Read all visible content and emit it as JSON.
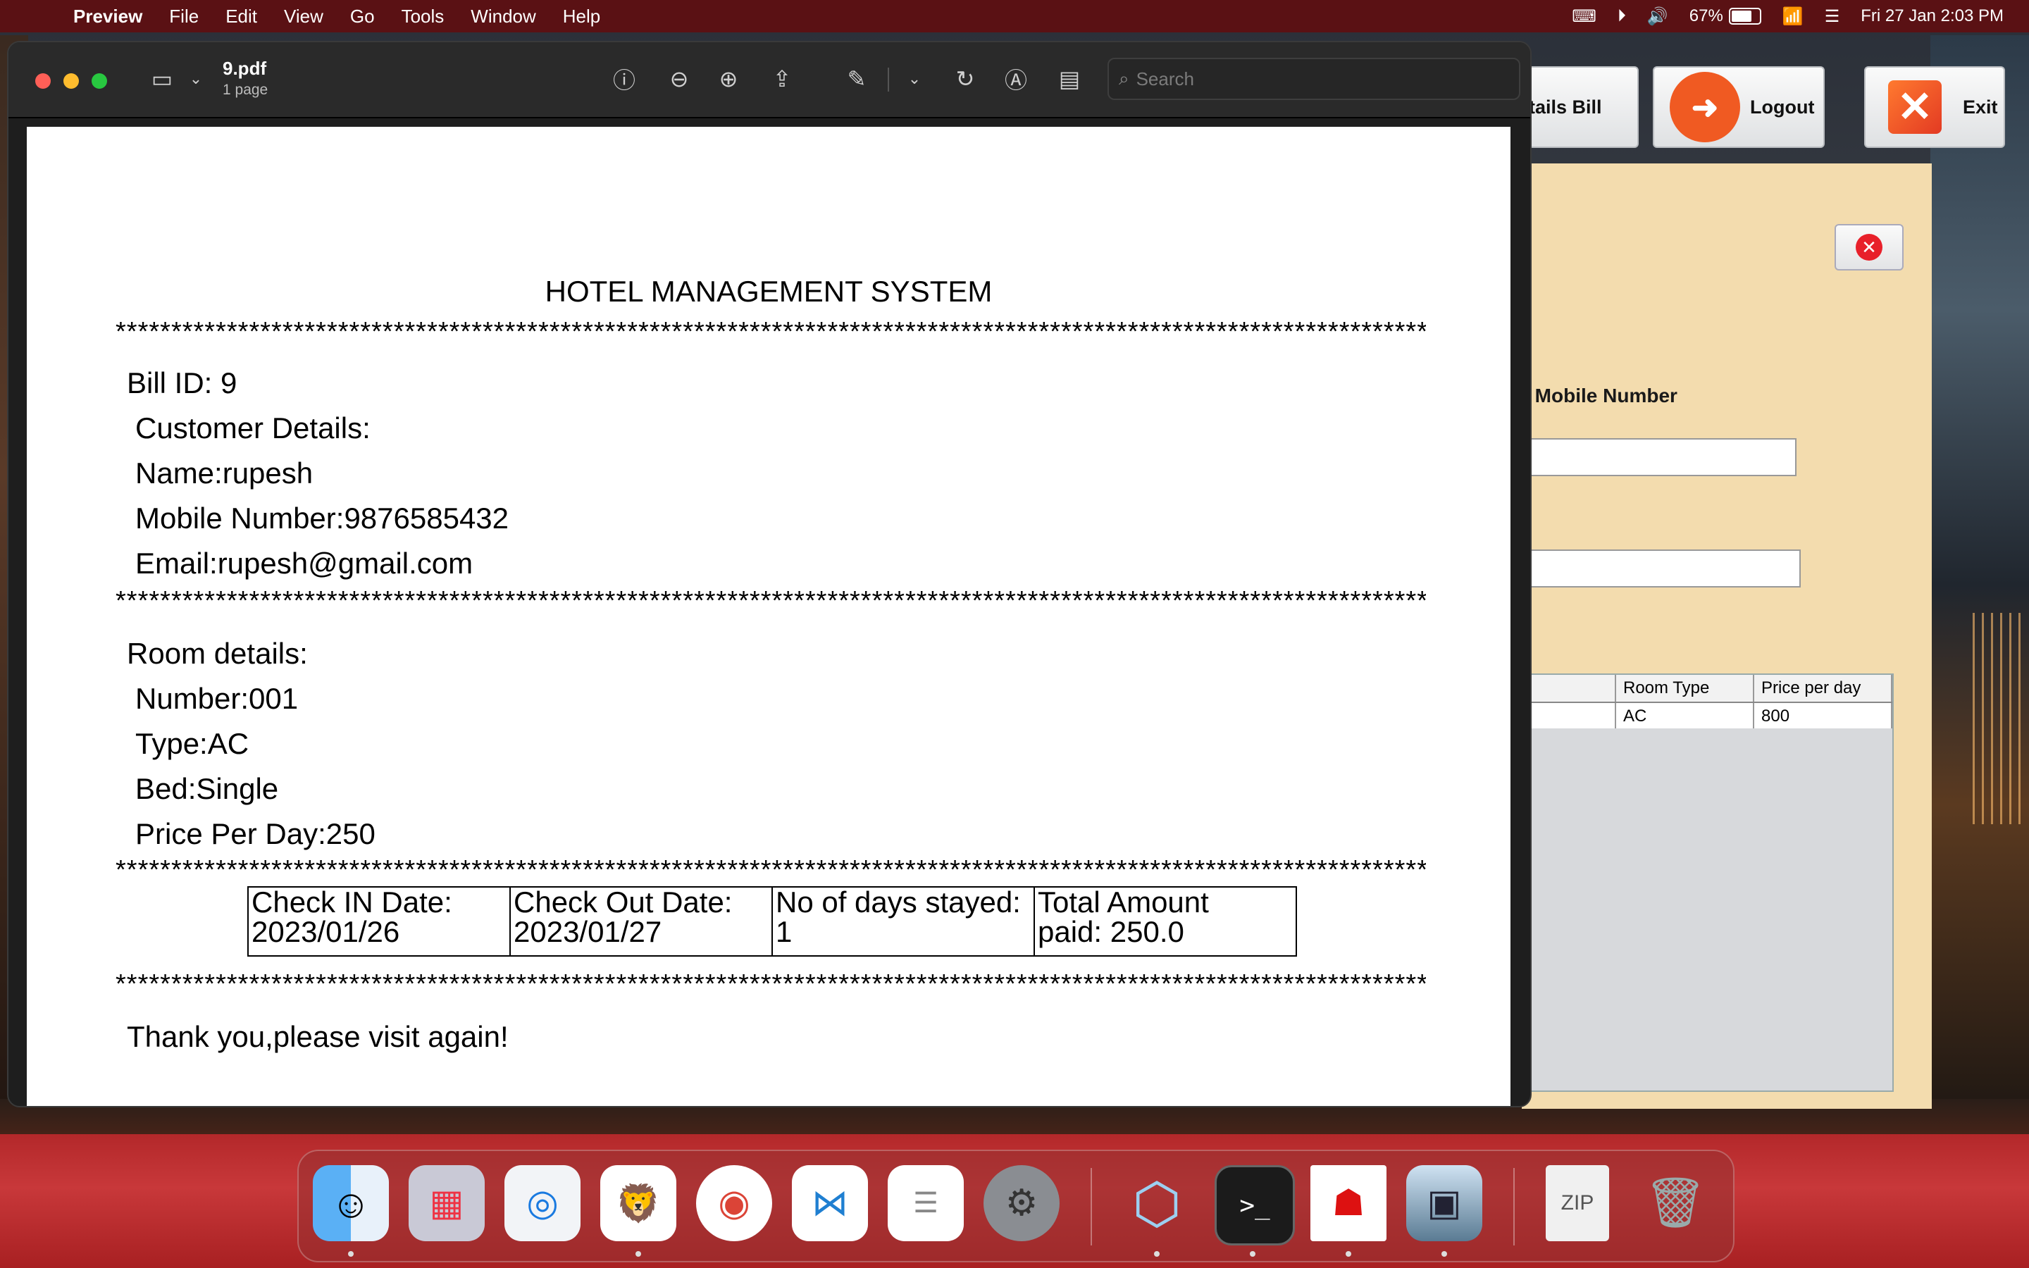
{
  "menubar": {
    "app_name": "Preview",
    "items": [
      "File",
      "Edit",
      "View",
      "Go",
      "Tools",
      "Window",
      "Help"
    ],
    "battery_percent": "67%",
    "battery_level": 0.67,
    "datetime": "Fri 27 Jan  2:03 PM"
  },
  "preview": {
    "doc_title": "9.pdf",
    "doc_pages": "1 page",
    "search_placeholder": "Search"
  },
  "bill": {
    "heading": "HOTEL MANAGEMENT SYSTEM",
    "stars": "****************************************************************************************************************************",
    "bill_id": "Bill ID: 9",
    "customer_header": "Customer Details:",
    "name": "Name:rupesh",
    "mobile": "Mobile Number:9876585432",
    "email": "Email:rupesh@gmail.com",
    "room_header": "Room details:",
    "room_number": "Number:001",
    "room_type": "Type:AC",
    "bed": "Bed:Single",
    "price": "Price Per Day:250",
    "table": {
      "checkin_label": "Check IN Date:",
      "checkin_value": "2023/01/26",
      "checkout_label": "Check Out Date:",
      "checkout_value": "2023/01/27",
      "days_label": "No of days stayed:",
      "days_value": "1",
      "total_label": "Total Amount",
      "total_value": "paid: 250.0"
    },
    "footer": "Thank you,please visit again!"
  },
  "background_app": {
    "details_bill_label": "tails Bill",
    "logout_label": "Logout",
    "exit_label": "Exit",
    "mobile_label": "r Mobile Number",
    "table_headers": [
      "",
      "Room Type",
      "Price per day"
    ],
    "table_row": [
      "",
      "AC",
      "800"
    ]
  },
  "dock": {
    "apps": [
      "finder",
      "launchpad",
      "safari",
      "brave",
      "chrome",
      "vscode",
      "reminders",
      "system-settings",
      "netbeans",
      "terminal",
      "java",
      "preview",
      "archive",
      "trash"
    ]
  }
}
